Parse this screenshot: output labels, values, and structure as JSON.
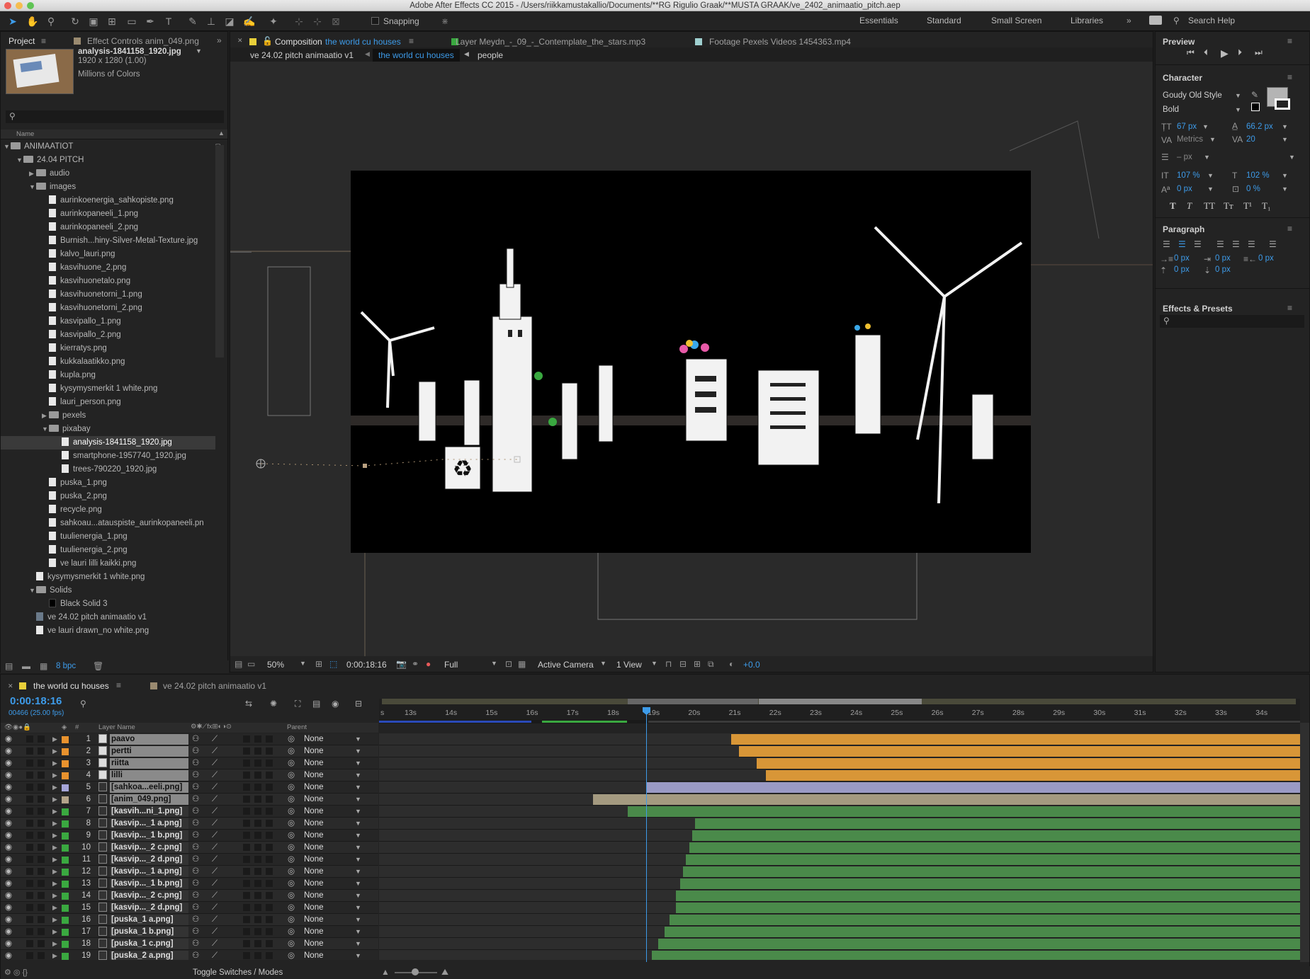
{
  "window": {
    "title": "Adobe After Effects CC 2015 - /Users/riikkamustakallio/Documents/**RG Rigulio Graak/**MUSTA GRAAK/ve_2402_animaatio_pitch.aep"
  },
  "toolbar": {
    "snapping": "Snapping",
    "workspaces": [
      "Essentials",
      "Standard",
      "Small Screen",
      "Libraries"
    ],
    "search": "Search Help"
  },
  "project": {
    "tab": "Project",
    "effect_tab": "Effect Controls anim_049.png",
    "selected_name": "analysis-1841158_1920.jpg",
    "selected_dims": "1920 x 1280 (1.00)",
    "selected_colors": "Millions of Colors",
    "col_name": "Name",
    "bpc": "8 bpc",
    "tree": [
      {
        "d": 0,
        "t": "fold",
        "open": true,
        "n": "ANIMAATIOT"
      },
      {
        "d": 1,
        "t": "fold",
        "open": true,
        "n": "24.04 PITCH"
      },
      {
        "d": 2,
        "t": "fold",
        "open": false,
        "n": "audio"
      },
      {
        "d": 2,
        "t": "fold",
        "open": true,
        "n": "images"
      },
      {
        "d": 3,
        "t": "file",
        "n": "aurinkoenergia_sahkopiste.png"
      },
      {
        "d": 3,
        "t": "file",
        "n": "aurinkopaneeli_1.png"
      },
      {
        "d": 3,
        "t": "file",
        "n": "aurinkopaneeli_2.png"
      },
      {
        "d": 3,
        "t": "file",
        "n": "Burnish...hiny-Silver-Metal-Texture.jpg"
      },
      {
        "d": 3,
        "t": "file",
        "n": "kalvo_lauri.png"
      },
      {
        "d": 3,
        "t": "file",
        "n": "kasvihuone_2.png"
      },
      {
        "d": 3,
        "t": "file",
        "n": "kasvihuonetalo.png"
      },
      {
        "d": 3,
        "t": "file",
        "n": "kasvihuonetorni_1.png"
      },
      {
        "d": 3,
        "t": "file",
        "n": "kasvihuonetorni_2.png"
      },
      {
        "d": 3,
        "t": "file",
        "n": "kasvipallo_1.png"
      },
      {
        "d": 3,
        "t": "file",
        "n": "kasvipallo_2.png"
      },
      {
        "d": 3,
        "t": "file",
        "n": "kierratys.png"
      },
      {
        "d": 3,
        "t": "file",
        "n": "kukkalaatikko.png"
      },
      {
        "d": 3,
        "t": "file",
        "n": "kupla.png"
      },
      {
        "d": 3,
        "t": "file",
        "n": "kysymysmerkit 1 white.png"
      },
      {
        "d": 3,
        "t": "file",
        "n": "lauri_person.png"
      },
      {
        "d": 3,
        "t": "fold",
        "open": false,
        "n": "pexels"
      },
      {
        "d": 3,
        "t": "fold",
        "open": true,
        "n": "pixabay"
      },
      {
        "d": 4,
        "t": "file",
        "n": "analysis-1841158_1920.jpg",
        "sel": true
      },
      {
        "d": 4,
        "t": "file",
        "n": "smartphone-1957740_1920.jpg"
      },
      {
        "d": 4,
        "t": "file",
        "n": "trees-790220_1920.jpg"
      },
      {
        "d": 3,
        "t": "file",
        "n": "puska_1.png"
      },
      {
        "d": 3,
        "t": "file",
        "n": "puska_2.png"
      },
      {
        "d": 3,
        "t": "file",
        "n": "recycle.png"
      },
      {
        "d": 3,
        "t": "file",
        "n": "sahkoau...atauspiste_aurinkopaneeli.pn"
      },
      {
        "d": 3,
        "t": "file",
        "n": "tuulienergia_1.png"
      },
      {
        "d": 3,
        "t": "file",
        "n": "tuulienergia_2.png"
      },
      {
        "d": 3,
        "t": "file",
        "n": "ve lauri lilli kaikki.png"
      },
      {
        "d": 2,
        "t": "file",
        "n": "kysymysmerkit 1 white.png"
      },
      {
        "d": 2,
        "t": "fold",
        "open": true,
        "n": "Solids"
      },
      {
        "d": 3,
        "t": "solid",
        "n": "Black Solid 3"
      },
      {
        "d": 2,
        "t": "comp",
        "n": "ve 24.02 pitch animaatio v1"
      },
      {
        "d": 2,
        "t": "file",
        "n": "ve lauri drawn_no white.png"
      }
    ]
  },
  "viewer": {
    "tabs": [
      "Composition",
      "the world cu houses",
      "Layer Meydn_-_09_-_Contemplate_the_stars.mp3",
      "Footage Pexels Videos 1454363.mp4"
    ],
    "breadcrumbs": [
      "ve 24.02 pitch animaatio v1",
      "the world cu houses",
      "people"
    ],
    "zoom": "50%",
    "timecode": "0:00:18:16",
    "resolution": "Full",
    "camera": "Active Camera",
    "views": "1 View",
    "exposure": "+0.0"
  },
  "preview": {
    "title": "Preview"
  },
  "character": {
    "title": "Character",
    "font": "Goudy Old Style",
    "style": "Bold",
    "size": "67 px",
    "leading": "66.2 px",
    "kerning": "Metrics",
    "tracking": "20",
    "stroke": "– px",
    "vscale": "107 %",
    "hscale": "102 %",
    "baseline": "0 px",
    "tsume": "0 %",
    "styles": [
      "T",
      "T",
      "TT",
      "Tт",
      "T¹",
      "T₁"
    ]
  },
  "paragraph": {
    "title": "Paragraph",
    "indent_left": "0 px",
    "indent_first": "0 px",
    "indent_right": "0 px",
    "space_before": "0 px",
    "space_after": "0 px"
  },
  "effects": {
    "title": "Effects & Presets"
  },
  "timeline": {
    "tab": "the world cu houses",
    "tab2": "ve 24.02 pitch animaatio v1",
    "timecode": "0:00:18:16",
    "frames": "00466 (25.00 fps)",
    "col_name": "Layer Name",
    "col_parent": "Parent",
    "toggle": "Toggle Switches / Modes",
    "ticks": [
      "s",
      "13s",
      "14s",
      "15s",
      "16s",
      "17s",
      "18s",
      "19s",
      "20s",
      "21s",
      "22s",
      "23s",
      "24s",
      "25s",
      "26s",
      "27s",
      "28s",
      "29s",
      "30s",
      "31s",
      "32s",
      "33s",
      "34s"
    ],
    "layers": [
      {
        "n": "1",
        "name": "paavo",
        "c": "#e8922e",
        "start": 0.382,
        "bar": "#d89637"
      },
      {
        "n": "2",
        "name": "pertti",
        "c": "#e8922e",
        "start": 0.391,
        "bar": "#d89637"
      },
      {
        "n": "3",
        "name": "riitta",
        "c": "#e8922e",
        "start": 0.41,
        "bar": "#d89637"
      },
      {
        "n": "4",
        "name": "lilli",
        "c": "#e8922e",
        "start": 0.42,
        "bar": "#d89637"
      },
      {
        "n": "5",
        "name": "[sahkoa...eeli.png]",
        "c": "#a5a5d8",
        "start": 0.29,
        "bar": "#9a9ac4"
      },
      {
        "n": "6",
        "name": "[anim_049.png]",
        "c": "#b4a48a",
        "start": 0.232,
        "bar": "#a49a80"
      },
      {
        "n": "7",
        "name": "[kasvih...ni_1.png]",
        "c": "#3aa840",
        "start": 0.27,
        "bar": "#4a8a4a"
      },
      {
        "n": "8",
        "name": "[kasvip..._1 a.png]",
        "c": "#3aa840",
        "start": 0.343,
        "bar": "#4a8a4a"
      },
      {
        "n": "9",
        "name": "[kasvip..._1 b.png]",
        "c": "#3aa840",
        "start": 0.34,
        "bar": "#4a8a4a"
      },
      {
        "n": "10",
        "name": "[kasvip..._2 c.png]",
        "c": "#3aa840",
        "start": 0.337,
        "bar": "#4a8a4a"
      },
      {
        "n": "11",
        "name": "[kasvip..._2 d.png]",
        "c": "#3aa840",
        "start": 0.333,
        "bar": "#4a8a4a"
      },
      {
        "n": "12",
        "name": "[kasvip..._1 a.png]",
        "c": "#3aa840",
        "start": 0.33,
        "bar": "#4a8a4a"
      },
      {
        "n": "13",
        "name": "[kasvip..._1 b.png]",
        "c": "#3aa840",
        "start": 0.327,
        "bar": "#4a8a4a"
      },
      {
        "n": "14",
        "name": "[kasvip..._2 c.png]",
        "c": "#3aa840",
        "start": 0.322,
        "bar": "#4a8a4a"
      },
      {
        "n": "15",
        "name": "[kasvip..._2 d.png]",
        "c": "#3aa840",
        "start": 0.322,
        "bar": "#4a8a4a"
      },
      {
        "n": "16",
        "name": "[puska_1 a.png]",
        "c": "#3aa840",
        "start": 0.315,
        "bar": "#4a8a4a"
      },
      {
        "n": "17",
        "name": "[puska_1 b.png]",
        "c": "#3aa840",
        "start": 0.31,
        "bar": "#4a8a4a"
      },
      {
        "n": "18",
        "name": "[puska_1 c.png]",
        "c": "#3aa840",
        "start": 0.303,
        "bar": "#4a8a4a"
      },
      {
        "n": "19",
        "name": "[puska_2 a.png]",
        "c": "#3aa840",
        "start": 0.296,
        "bar": "#4a8a4a"
      }
    ],
    "parent": "None"
  }
}
